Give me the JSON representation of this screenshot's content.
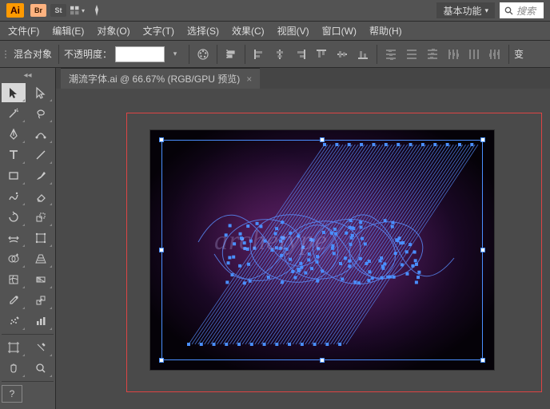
{
  "app": {
    "logo": "Ai"
  },
  "topbar": {
    "badges": [
      {
        "name": "br-badge",
        "text": "Br"
      },
      {
        "name": "st-badge",
        "text": "St"
      }
    ],
    "workspace_label": "基本功能",
    "search_placeholder": "搜索"
  },
  "menus": [
    {
      "name": "file",
      "label": "文件(F)"
    },
    {
      "name": "edit",
      "label": "编辑(E)"
    },
    {
      "name": "object",
      "label": "对象(O)"
    },
    {
      "name": "type",
      "label": "文字(T)"
    },
    {
      "name": "select",
      "label": "选择(S)"
    },
    {
      "name": "effect",
      "label": "效果(C)"
    },
    {
      "name": "view",
      "label": "视图(V)"
    },
    {
      "name": "window",
      "label": "窗口(W)"
    },
    {
      "name": "help",
      "label": "帮助(H)"
    }
  ],
  "control": {
    "object_label": "混合对象",
    "opacity_label": "不透明度：",
    "transform_label": "变"
  },
  "tab": {
    "title": "潮流字体.ai @ 66.67% (RGB/GPU 预览)"
  },
  "artwork": {
    "text": "archetype"
  },
  "tools": [
    {
      "name": "selection-tool",
      "icon": "select",
      "active": true
    },
    {
      "name": "direct-selection-tool",
      "icon": "direct"
    },
    {
      "name": "magic-wand-tool",
      "icon": "wand"
    },
    {
      "name": "lasso-tool",
      "icon": "lasso"
    },
    {
      "name": "pen-tool",
      "icon": "pen"
    },
    {
      "name": "curvature-tool",
      "icon": "curve"
    },
    {
      "name": "type-tool",
      "icon": "type"
    },
    {
      "name": "line-segment-tool",
      "icon": "line"
    },
    {
      "name": "rectangle-tool",
      "icon": "rect"
    },
    {
      "name": "paintbrush-tool",
      "icon": "brush"
    },
    {
      "name": "shaper-tool",
      "icon": "shaper"
    },
    {
      "name": "eraser-tool",
      "icon": "eraser"
    },
    {
      "name": "rotate-tool",
      "icon": "rotate"
    },
    {
      "name": "scale-tool",
      "icon": "scale"
    },
    {
      "name": "width-tool",
      "icon": "width"
    },
    {
      "name": "free-transform-tool",
      "icon": "freetrans"
    },
    {
      "name": "shape-builder-tool",
      "icon": "shapebuild"
    },
    {
      "name": "perspective-grid-tool",
      "icon": "persp"
    },
    {
      "name": "mesh-tool",
      "icon": "mesh"
    },
    {
      "name": "gradient-tool",
      "icon": "gradient"
    },
    {
      "name": "eyedropper-tool",
      "icon": "eyedrop"
    },
    {
      "name": "blend-tool",
      "icon": "blend"
    },
    {
      "name": "symbol-sprayer-tool",
      "icon": "spray"
    },
    {
      "name": "column-graph-tool",
      "icon": "graph"
    },
    {
      "name": "artboard-tool",
      "icon": "artboard"
    },
    {
      "name": "slice-tool",
      "icon": "slice"
    },
    {
      "name": "hand-tool",
      "icon": "hand"
    },
    {
      "name": "zoom-tool",
      "icon": "zoom"
    }
  ]
}
